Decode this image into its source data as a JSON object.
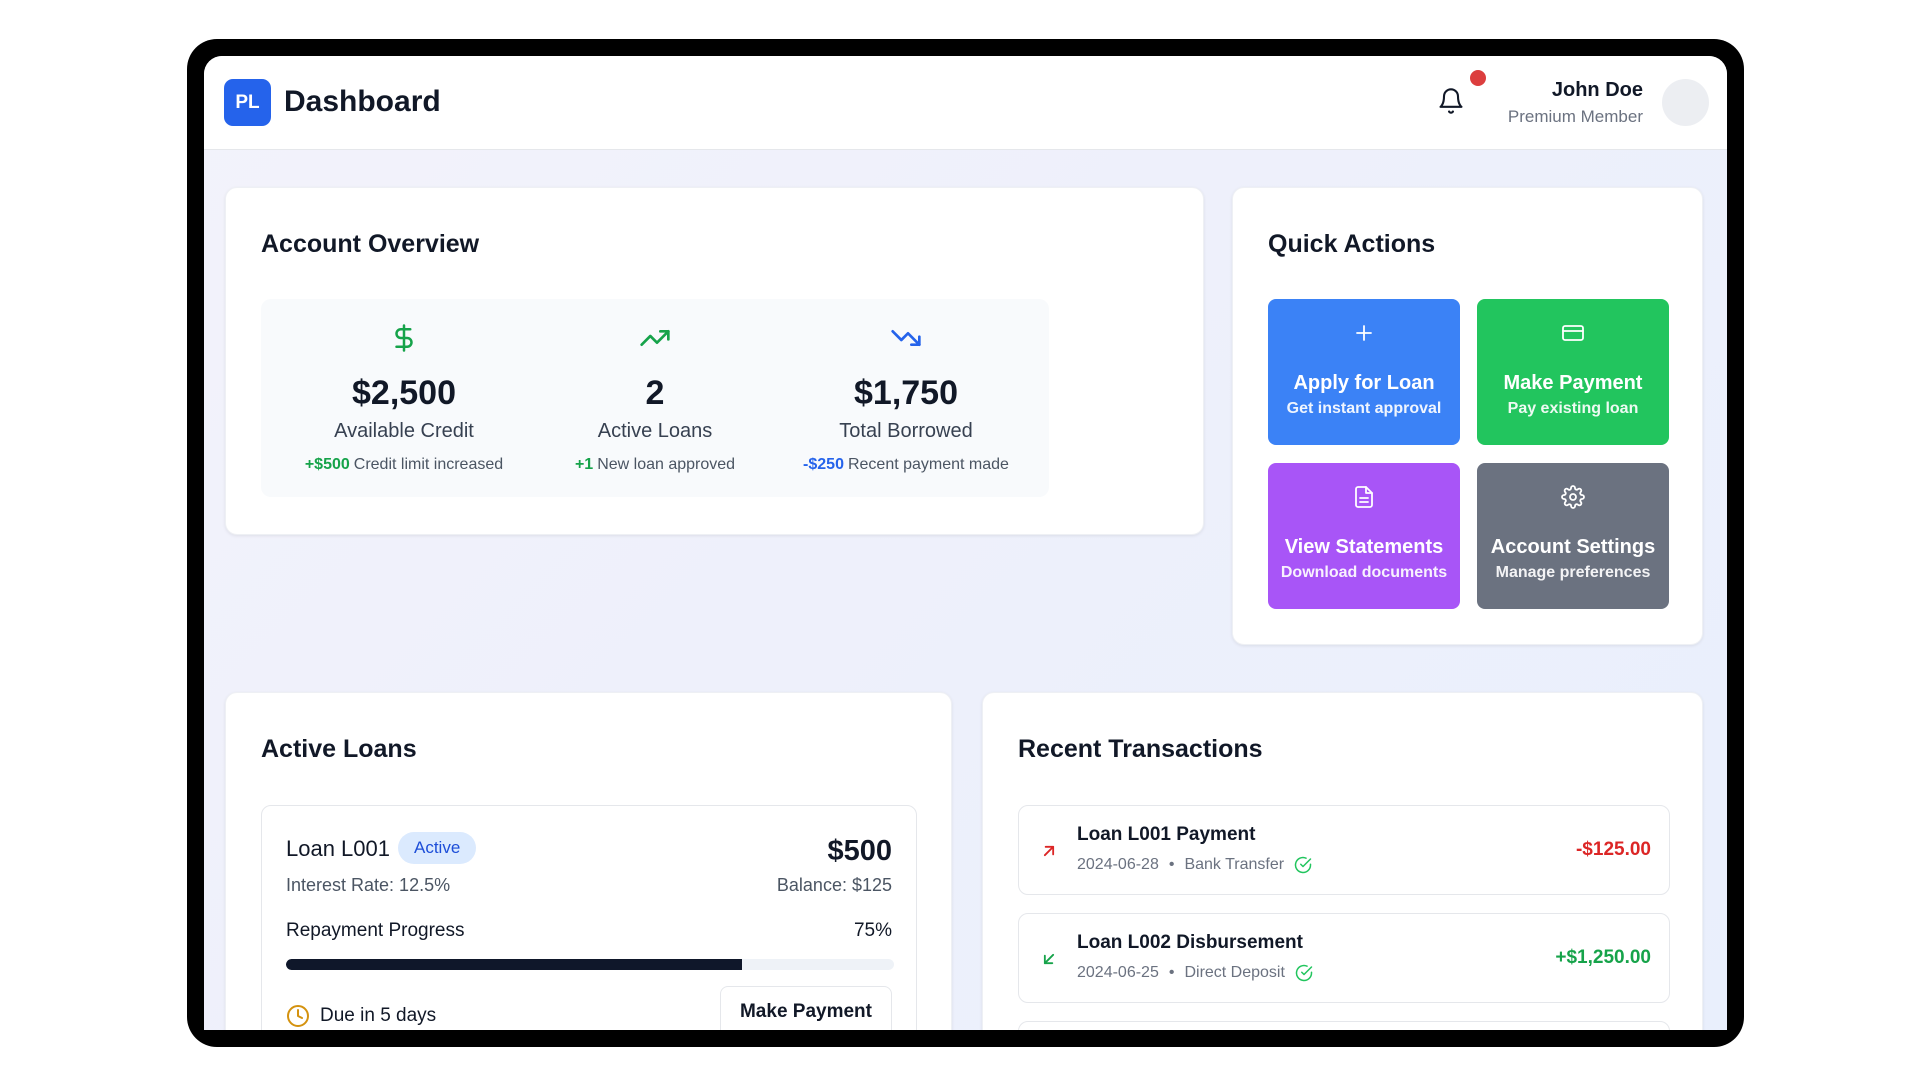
{
  "header": {
    "logo_text": "PL",
    "title": "Dashboard",
    "user_name": "John Doe",
    "user_role": "Premium Member"
  },
  "overview": {
    "title": "Account Overview",
    "stats": [
      {
        "icon": "dollar-icon",
        "value": "$2,500",
        "label": "Available Credit",
        "delta": "+$500",
        "note": "Credit limit increased",
        "color": "#16a34a"
      },
      {
        "icon": "trending-up-icon",
        "value": "2",
        "label": "Active Loans",
        "delta": "+1",
        "note": "New loan approved",
        "color": "#16a34a"
      },
      {
        "icon": "trending-down-icon",
        "value": "$1,750",
        "label": "Total Borrowed",
        "delta": "-$250",
        "note": "Recent payment made",
        "color": "#2563eb"
      }
    ]
  },
  "quick_actions": {
    "title": "Quick Actions",
    "items": [
      {
        "icon": "plus-icon",
        "title": "Apply for Loan",
        "subtitle": "Get instant approval",
        "color": "#3b82f6"
      },
      {
        "icon": "credit-card-icon",
        "title": "Make Payment",
        "subtitle": "Pay existing loan",
        "color": "#22c55e"
      },
      {
        "icon": "document-icon",
        "title": "View Statements",
        "subtitle": "Download documents",
        "color": "#a855f7"
      },
      {
        "icon": "gear-icon",
        "title": "Account Settings",
        "subtitle": "Manage preferences",
        "color": "#6b7280"
      }
    ]
  },
  "active_loans": {
    "title": "Active Loans",
    "loans": [
      {
        "name": "Loan L001",
        "status": "Active",
        "amount": "$500",
        "interest": "Interest Rate: 12.5%",
        "balance": "Balance: $125",
        "progress_label": "Repayment Progress",
        "progress_text": "75%",
        "progress_fraction": 0.75,
        "due": "Due in 5 days",
        "action": "Make Payment"
      }
    ]
  },
  "transactions": {
    "title": "Recent Transactions",
    "items": [
      {
        "direction": "out",
        "title": "Loan L001 Payment",
        "date": "2024-06-28",
        "method": "Bank Transfer",
        "amount": "-$125.00",
        "color": "#dc2626"
      },
      {
        "direction": "in",
        "title": "Loan L002 Disbursement",
        "date": "2024-06-25",
        "method": "Direct Deposit",
        "amount": "+$1,250.00",
        "color": "#16a34a"
      }
    ]
  },
  "colors": {
    "primary": "#2563eb",
    "notification": "#dc3e3e",
    "success": "#16a34a",
    "danger": "#dc2626"
  }
}
